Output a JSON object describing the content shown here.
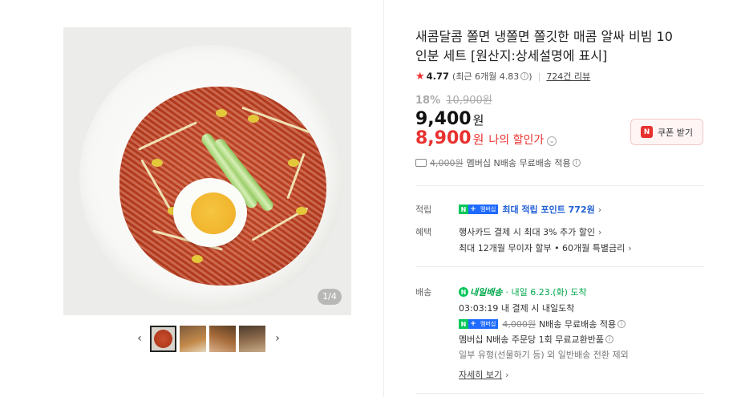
{
  "product": {
    "title": "새콤달콤 쫄면 냉쫄면 쫄깃한 매콤 알싸 비빔 10인분 세트 [원산지:상세설명에 표시]",
    "rating": "4.77",
    "rating_recent": "(최근 6개월 4.83",
    "review_count": "724건 리뷰",
    "discount_rate": "18%",
    "original_price": "10,900원",
    "price": "9,400",
    "price_unit": "원",
    "my_price": "8,900",
    "my_price_unit": "원",
    "my_discount_label": "나의 할인가",
    "coupon_label": "쿠폰 받기",
    "coupon_icon": "N",
    "shipping_orig": "4,000원",
    "shipping_note": "멤버십 N배송 무료배송 적용"
  },
  "gallery": {
    "counter": "1/4",
    "prev": "‹",
    "next": "›"
  },
  "points": {
    "label": "적립",
    "badge_n": "N",
    "badge_plus": "+",
    "badge_member": "멤버십",
    "text": "최대 적립 포인트 772원"
  },
  "benefits": {
    "label": "혜택",
    "line1": "행사카드 결제 시 최대 3% 추가 할인",
    "line2": "최대 12개월 무이자 할부 • 60개월 특별금리"
  },
  "delivery": {
    "label": "배송",
    "tomorrow_brand": "내일배송",
    "arrival": "· 내일 6.23.(화) 도착",
    "countdown": "03:03:19  내 결제 시 내일도착",
    "ship_orig": "4,000원",
    "ship_note": "N배송 무료배송 적용",
    "exchange": "멤버십 N배송 주문당 1회 무료교환반품",
    "exception": "일부 유형(선물하기 등) 외 일반배송 전환 제외",
    "details_link": "자세히 보기"
  }
}
